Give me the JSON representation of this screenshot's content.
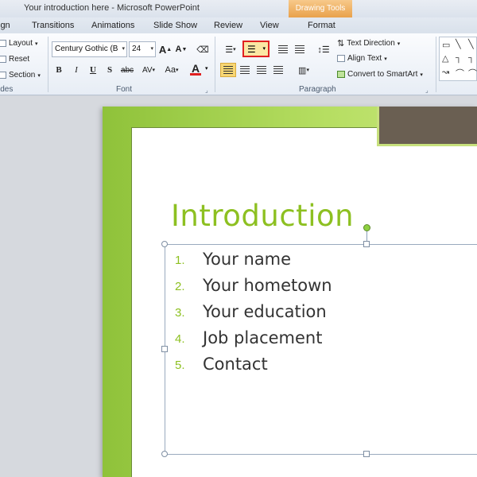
{
  "window": {
    "title": "Your introduction here - Microsoft PowerPoint",
    "context_tab": "Drawing Tools"
  },
  "tabs": [
    "ign",
    "Transitions",
    "Animations",
    "Slide Show",
    "Review",
    "View",
    "Format"
  ],
  "ribbon": {
    "slides": {
      "layout": "Layout",
      "reset": "Reset",
      "section": "Section",
      "label": "ides"
    },
    "font": {
      "name": "Century Gothic (B",
      "size": "24",
      "label": "Font",
      "grow": "A",
      "shrink": "A",
      "bold": "B",
      "italic": "I",
      "underline": "U",
      "shadow": "S",
      "strike": "abc",
      "spacing": "AV",
      "case": "Aa",
      "color_letter": "A"
    },
    "paragraph": {
      "label": "Paragraph",
      "text_direction": "Text Direction",
      "align_text": "Align Text",
      "convert_smartart": "Convert to SmartArt"
    }
  },
  "slide": {
    "title": "Introduction",
    "items": [
      {
        "num": "1.",
        "text": "Your name"
      },
      {
        "num": "2.",
        "text": "Your hometown"
      },
      {
        "num": "3.",
        "text": "Your education"
      },
      {
        "num": "4.",
        "text": "Job placement"
      },
      {
        "num": "5.",
        "text": "Contact"
      }
    ]
  },
  "colors": {
    "accent_green": "#8dc021",
    "highlight_box": "#e02020",
    "context_orange": "#e9a14b"
  }
}
